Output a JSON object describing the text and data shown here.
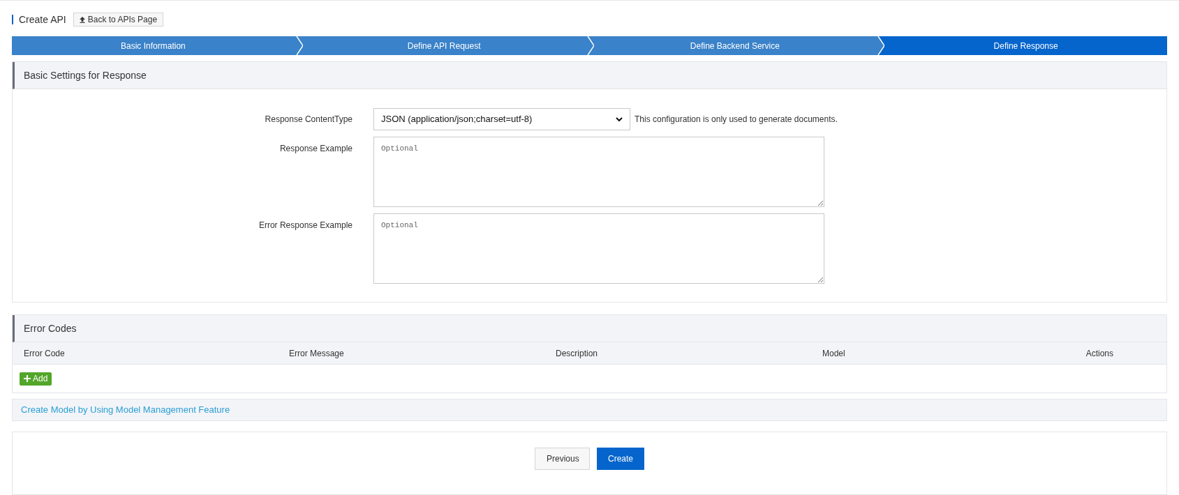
{
  "header": {
    "title": "Create API",
    "back_button": "Back to APIs Page"
  },
  "steps": [
    {
      "label": "Basic Information",
      "selected": false
    },
    {
      "label": "Define API Request",
      "selected": false
    },
    {
      "label": "Define Backend Service",
      "selected": false
    },
    {
      "label": "Define Response",
      "selected": true
    }
  ],
  "basic_settings": {
    "title": "Basic Settings for Response",
    "content_type": {
      "label": "Response ContentType",
      "value": "JSON (application/json;charset=utf-8)",
      "hint": "This configuration is only used to generate documents."
    },
    "response_example": {
      "label": "Response Example",
      "placeholder": "Optional"
    },
    "error_response_example": {
      "label": "Error Response Example",
      "placeholder": "Optional"
    }
  },
  "error_codes": {
    "title": "Error Codes",
    "columns": [
      "Error Code",
      "Error Message",
      "Description",
      "Model",
      "Actions"
    ],
    "add_button": "Add"
  },
  "model_link": "Create Model by Using Model Management Feature",
  "footer": {
    "buttons": [
      {
        "label": "Previous",
        "kind": "secondary"
      },
      {
        "label": "Create",
        "kind": "primary"
      }
    ]
  }
}
